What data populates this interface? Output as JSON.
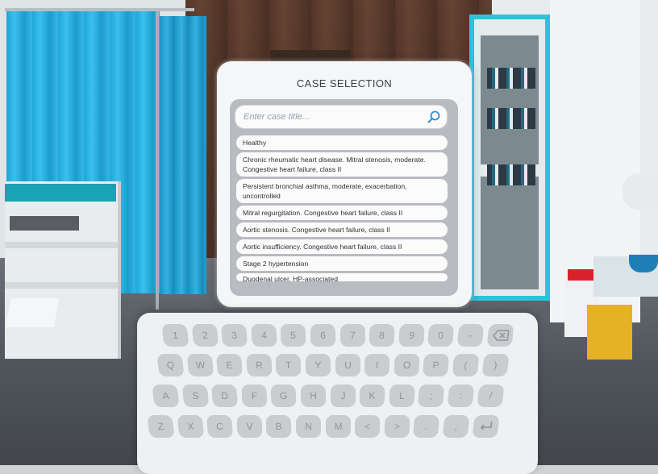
{
  "panel": {
    "title": "CASE SELECTION",
    "search": {
      "placeholder": "Enter case title...",
      "value": ""
    },
    "cases": [
      "Healthy",
      "Chronic rheumatic heart disease. Mitral stenosis, moderate. Congestive heart failure, class II",
      "Persistent bronchial asthma, moderate, exacerbation, uncontrolled",
      "Mitral regurgitation. Congestive heart failure, class II",
      "Aortic stenosis. Congestive heart failure, class II",
      "Aortic insufficiency. Congestive heart failure, class II",
      "Stage 2 hypertension",
      "Duodenal ulcer, HP-associated"
    ]
  },
  "keyboard": {
    "rows": [
      [
        "1",
        "2",
        "3",
        "4",
        "5",
        "6",
        "7",
        "8",
        "9",
        "0",
        "-",
        "⌫"
      ],
      [
        "Q",
        "W",
        "E",
        "R",
        "T",
        "Y",
        "U",
        "I",
        "O",
        "P",
        "(",
        ")"
      ],
      [
        "A",
        "S",
        "D",
        "F",
        "G",
        "H",
        "J",
        "K",
        "L",
        ";",
        ":",
        "/"
      ],
      [
        "Z",
        "X",
        "C",
        "V",
        "B",
        "N",
        "M",
        "<",
        ">",
        ".",
        ",",
        "↵"
      ]
    ]
  },
  "colors": {
    "accent": "#2e8fd6",
    "panel_bg": "#f4f6f7",
    "list_frame": "#b8bcc0",
    "key_bg": "#c9cdd0",
    "curtain": "#1da6d8",
    "cabinet_frame": "#2bc3d9"
  },
  "icons": {
    "search": "search-icon",
    "backspace": "backspace-icon",
    "enter": "enter-icon"
  }
}
